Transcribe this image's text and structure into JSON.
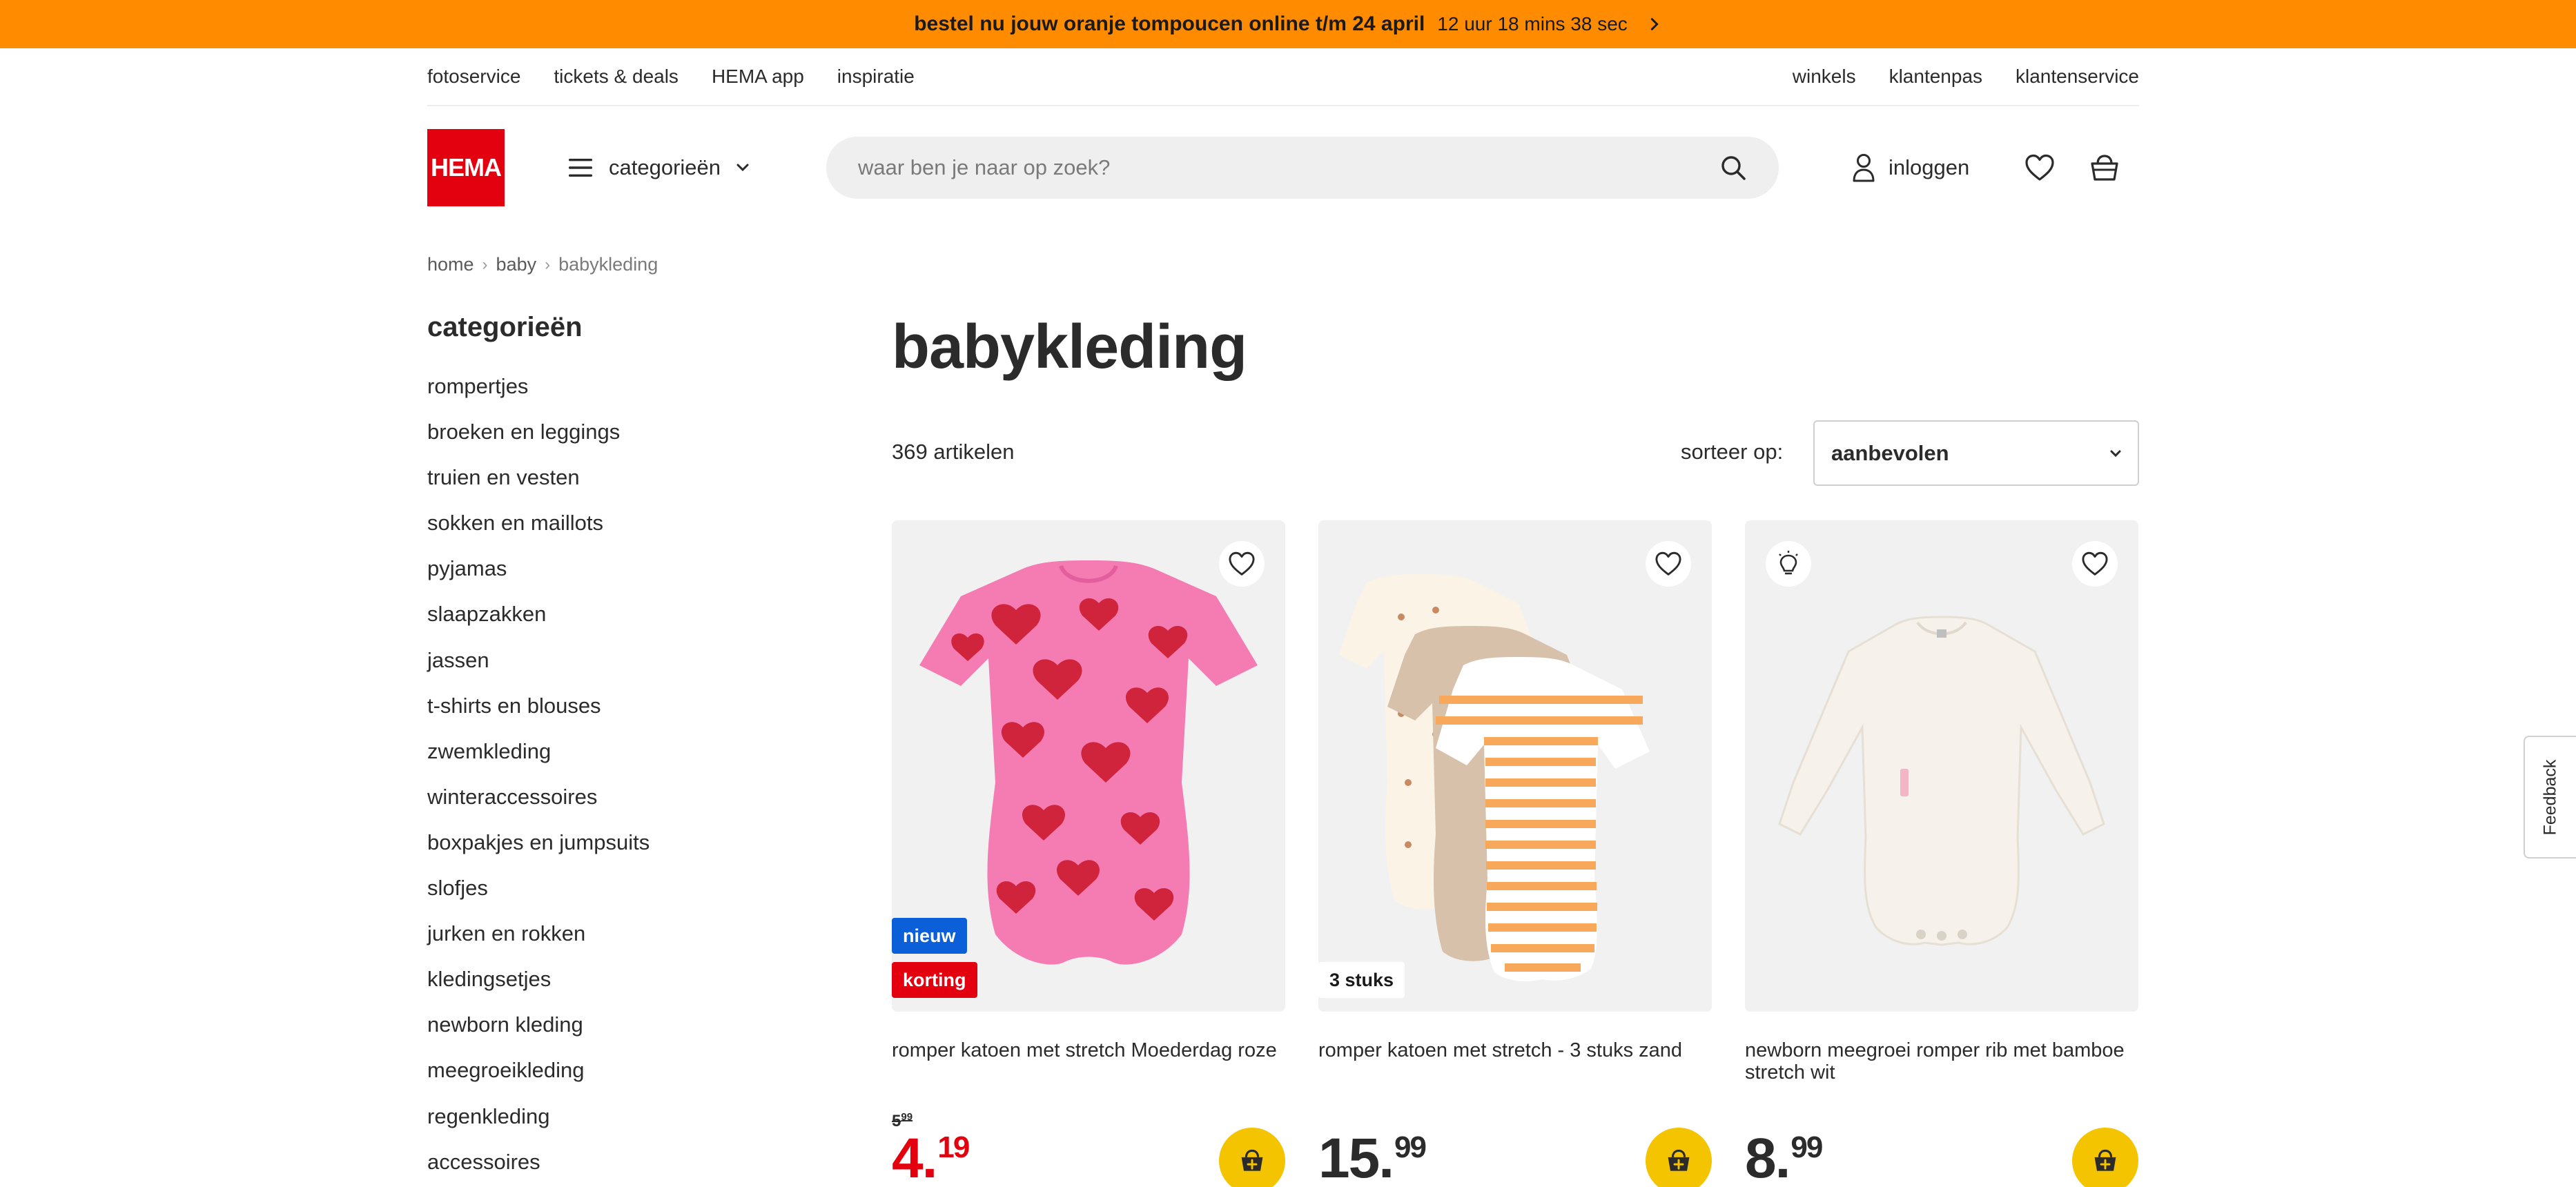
{
  "promo": {
    "headline": "bestel nu jouw oranje tompoucen online t/m 24 april",
    "countdown": "12 uur 18 mins 38 sec",
    "arrow_icon": "chevron-right-icon"
  },
  "utility_nav": {
    "left": [
      "fotoservice",
      "tickets & deals",
      "HEMA app",
      "inspiratie"
    ],
    "right": [
      "winkels",
      "klantenpas",
      "klantenservice"
    ]
  },
  "header": {
    "logo_text": "HEMA",
    "categories_label": "categorieën",
    "search_placeholder": "waar ben je naar op zoek?",
    "login_label": "inloggen"
  },
  "breadcrumb": {
    "items": [
      "home",
      "baby"
    ],
    "current": "babykleding"
  },
  "sidebar": {
    "title": "categorieën",
    "items": [
      "rompertjes",
      "broeken en leggings",
      "truien en vesten",
      "sokken en maillots",
      "pyjamas",
      "slaapzakken",
      "jassen",
      "t-shirts en blouses",
      "zwemkleding",
      "winteraccessoires",
      "boxpakjes en jumpsuits",
      "slofjes",
      "jurken en rokken",
      "kledingsetjes",
      "newborn kleding",
      "meegroeikleding",
      "regenkleding",
      "accessoires"
    ]
  },
  "main": {
    "title": "babykleding",
    "count": "369 artikelen",
    "sort_label": "sorteer op:",
    "sort_value": "aanbevolen"
  },
  "products": [
    {
      "title": "romper katoen met stretch Moederdag roze",
      "badges": [
        "nieuw",
        "korting"
      ],
      "old_price_int": "5",
      "old_price_dec": "99",
      "price_int": "4.",
      "price_dec": "19"
    },
    {
      "title": "romper katoen met stretch - 3 stuks zand",
      "badges": [
        "3 stuks"
      ],
      "price_int": "15.",
      "price_dec": "99"
    },
    {
      "title": "newborn meegroei romper rib met bamboe stretch wit",
      "badges": [],
      "price_int": "8.",
      "price_dec": "99"
    }
  ],
  "feedback_label": "Feedback",
  "colors": {
    "promo_bg": "#ff8c00",
    "brand_red": "#e3000f",
    "new_badge": "#0b5fd9",
    "cart_yellow": "#f5c400"
  }
}
